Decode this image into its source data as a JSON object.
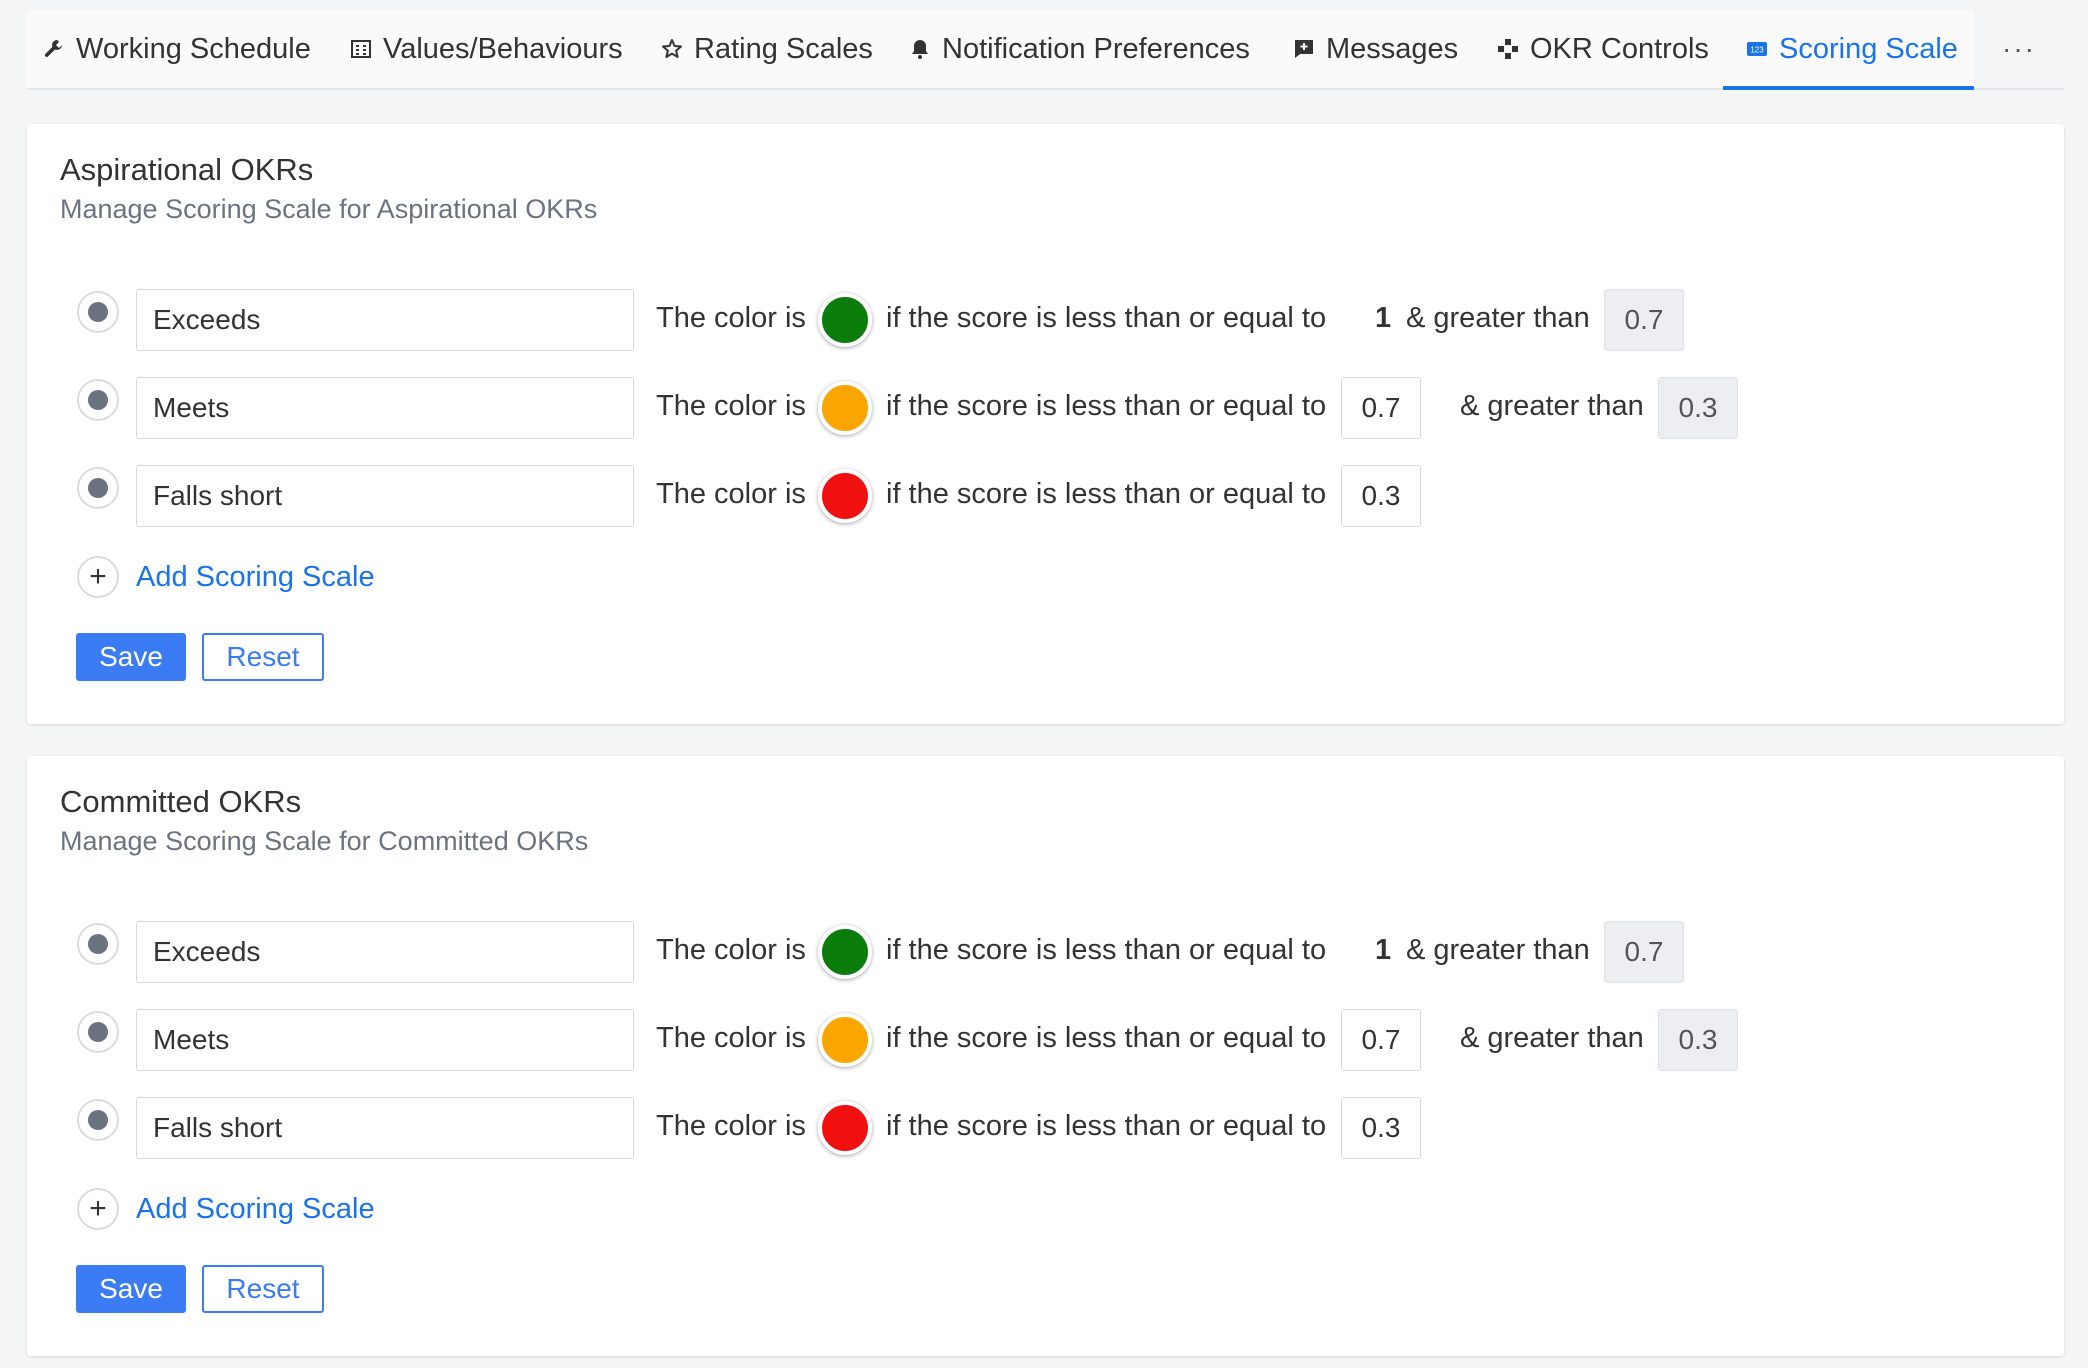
{
  "tabs": [
    {
      "label": "Working Schedule",
      "icon": "wrench-icon"
    },
    {
      "label": "Values/Behaviours",
      "icon": "building-icon"
    },
    {
      "label": "Rating Scales",
      "icon": "star-icon"
    },
    {
      "label": "Notification Preferences",
      "icon": "bell-icon"
    },
    {
      "label": "Messages",
      "icon": "message-icon"
    },
    {
      "label": "OKR Controls",
      "icon": "controls-icon"
    },
    {
      "label": "Scoring Scale",
      "icon": "numbers-icon",
      "active": true
    }
  ],
  "more_label": "···",
  "sections": [
    {
      "title": "Aspirational OKRs",
      "subtitle": "Manage Scoring Scale for Aspirational OKRs",
      "rows": [
        {
          "name": "Exceeds",
          "color": "#0a7d0a",
          "lte": "1",
          "gt": "0.7"
        },
        {
          "name": "Meets",
          "color": "#fba500",
          "lte": "0.7",
          "gt": "0.3"
        },
        {
          "name": "Falls short",
          "color": "#f01010",
          "lte": "0.3"
        }
      ]
    },
    {
      "title": "Committed OKRs",
      "subtitle": "Manage Scoring Scale for Committed OKRs",
      "rows": [
        {
          "name": "Exceeds",
          "color": "#0a7d0a",
          "lte": "1",
          "gt": "0.7"
        },
        {
          "name": "Meets",
          "color": "#fba500",
          "lte": "0.7",
          "gt": "0.3"
        },
        {
          "name": "Falls short",
          "color": "#f01010",
          "lte": "0.3"
        }
      ]
    }
  ],
  "labels": {
    "color_is": "The color is",
    "lte": "if the score is less than or equal to",
    "gt": "& greater than",
    "add": "Add Scoring Scale",
    "plus": "+",
    "save": "Save",
    "reset": "Reset"
  },
  "colors": {
    "accent": "#1a73e8",
    "button": "#3b7cf4"
  }
}
